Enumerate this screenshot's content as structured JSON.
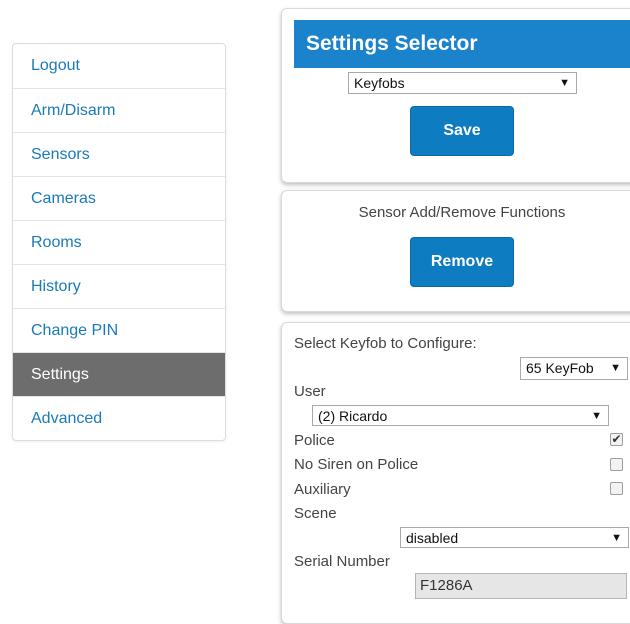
{
  "sidebar": {
    "items": [
      {
        "label": "Logout"
      },
      {
        "label": "Arm/Disarm"
      },
      {
        "label": "Sensors"
      },
      {
        "label": "Cameras"
      },
      {
        "label": "Rooms"
      },
      {
        "label": "History"
      },
      {
        "label": "Change PIN"
      },
      {
        "label": "Settings",
        "active": true
      },
      {
        "label": "Advanced"
      }
    ]
  },
  "settings_selector": {
    "title": "Settings Selector",
    "selected": "Keyfobs",
    "save_label": "Save"
  },
  "sensor_functions": {
    "title": "Sensor Add/Remove Functions",
    "remove_label": "Remove"
  },
  "keyfob_config": {
    "select_label": "Select Keyfob to Configure:",
    "keyfob_selected": "65 KeyFob",
    "user_label": "User",
    "user_selected": "(2) Ricardo",
    "police_label": "Police",
    "police_checked": true,
    "no_siren_label": "No Siren on Police",
    "no_siren_checked": false,
    "auxiliary_label": "Auxiliary",
    "auxiliary_checked": false,
    "scene_label": "Scene",
    "scene_selected": "disabled",
    "serial_label": "Serial Number",
    "serial_value": "F1286A"
  },
  "colors": {
    "accent": "#1b83cc",
    "button": "#0d7cc1",
    "link": "#1a7ab8",
    "active_nav": "#6d6d6d"
  },
  "icons": {
    "dropdown": "triangle-down-icon",
    "check": "check-mark-icon"
  }
}
